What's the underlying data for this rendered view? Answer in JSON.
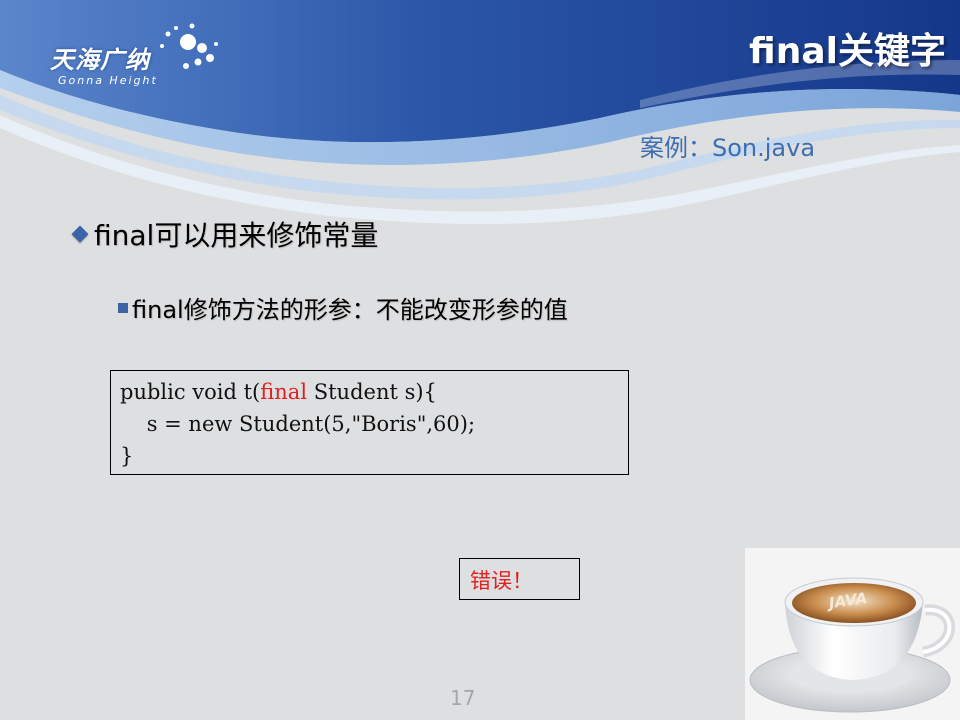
{
  "header": {
    "logo_cn": "天海广纳",
    "logo_en": "Gonna Height",
    "title": "final关键字"
  },
  "case_label": "案例：Son.java",
  "bullets": {
    "level1": "final可以用来修饰常量",
    "level2": "final修饰方法的形参：不能改变形参的值"
  },
  "code": {
    "line1_pre": "public void t(",
    "line1_kw": "final",
    "line1_post": " Student s){",
    "line2": "    s = new Student(5,\"Boris\",60);",
    "line3": "}"
  },
  "error_label": "错误！",
  "page_number": "17",
  "image": {
    "cup_text": "JAVA"
  },
  "colors": {
    "header_dark": "#1b3f93",
    "header_light": "#5b86cc",
    "accent_blue": "#3a63a8",
    "case_label": "#3e6eb0",
    "error_red": "#e02020",
    "background": "#dedfe1"
  }
}
